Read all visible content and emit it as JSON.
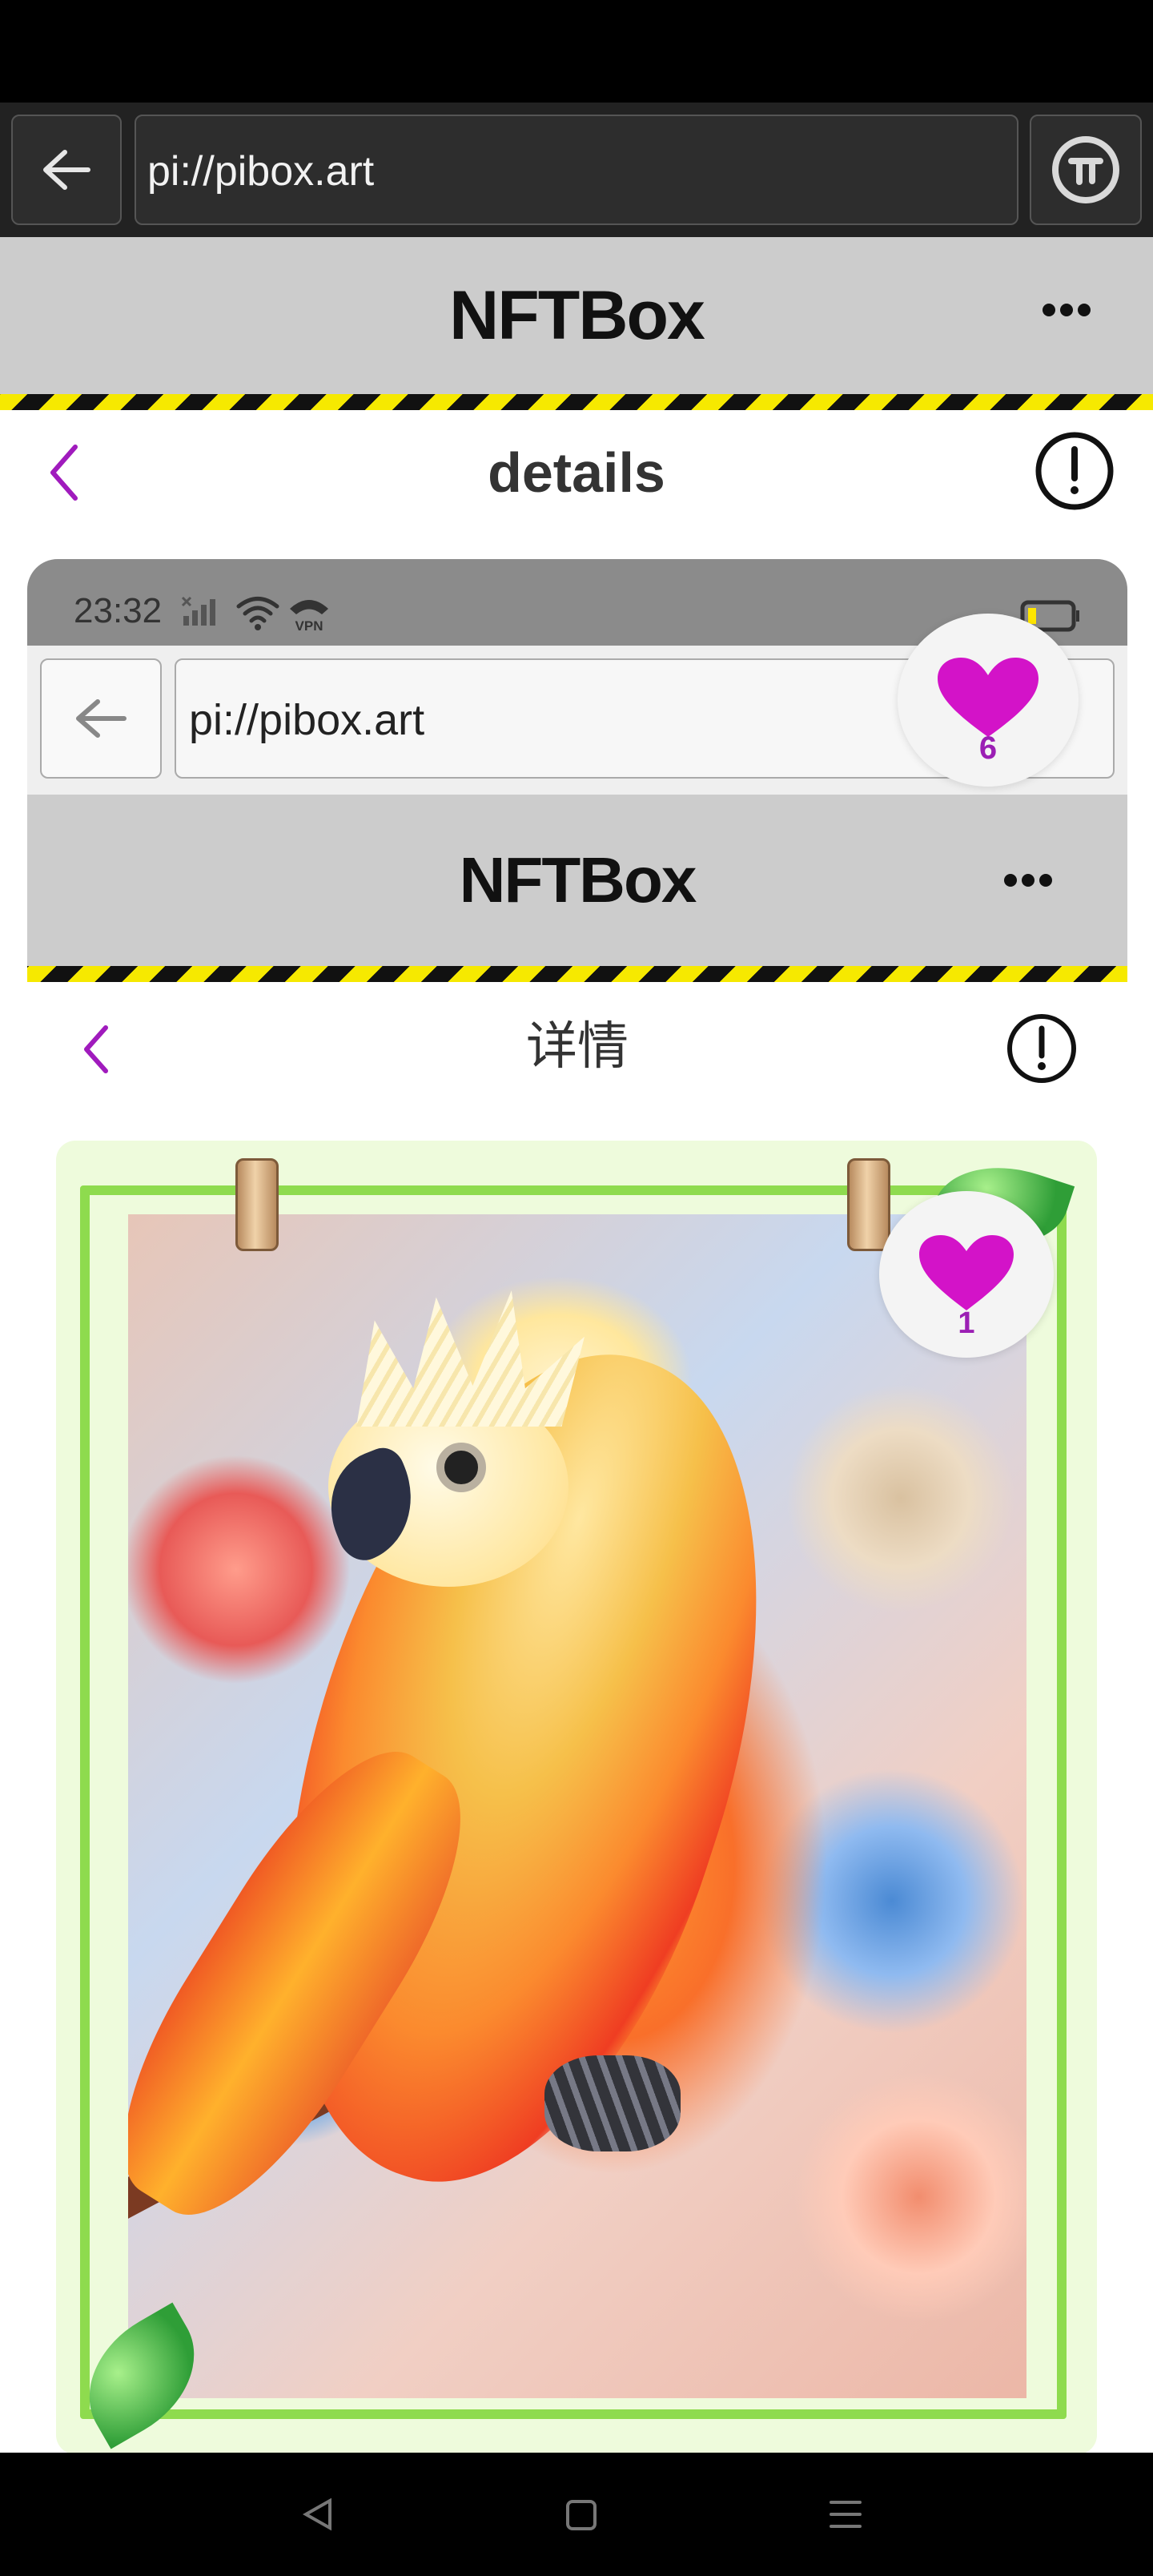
{
  "browser": {
    "url": "pi://pibox.art"
  },
  "app": {
    "title": "NFTBox",
    "nav_title": "details"
  },
  "embedded_screenshot": {
    "status_time": "23:32",
    "vpn_label": "VPN",
    "url": "pi://pibox.art",
    "app_title": "NFTBox",
    "nav_title": "详情"
  },
  "likes": {
    "outer_count": "6",
    "inner_count": "1"
  },
  "colors": {
    "accent": "#a01bbd",
    "heart": "#d313c8",
    "stripe_yellow": "#f6e900"
  },
  "icons": [
    "back-arrow-icon",
    "pi-logo-icon",
    "more-dots-icon",
    "chevron-left-icon",
    "info-icon",
    "heart-icon",
    "wifi-icon",
    "battery-icon",
    "android-back-icon",
    "android-home-icon",
    "android-menu-icon"
  ]
}
